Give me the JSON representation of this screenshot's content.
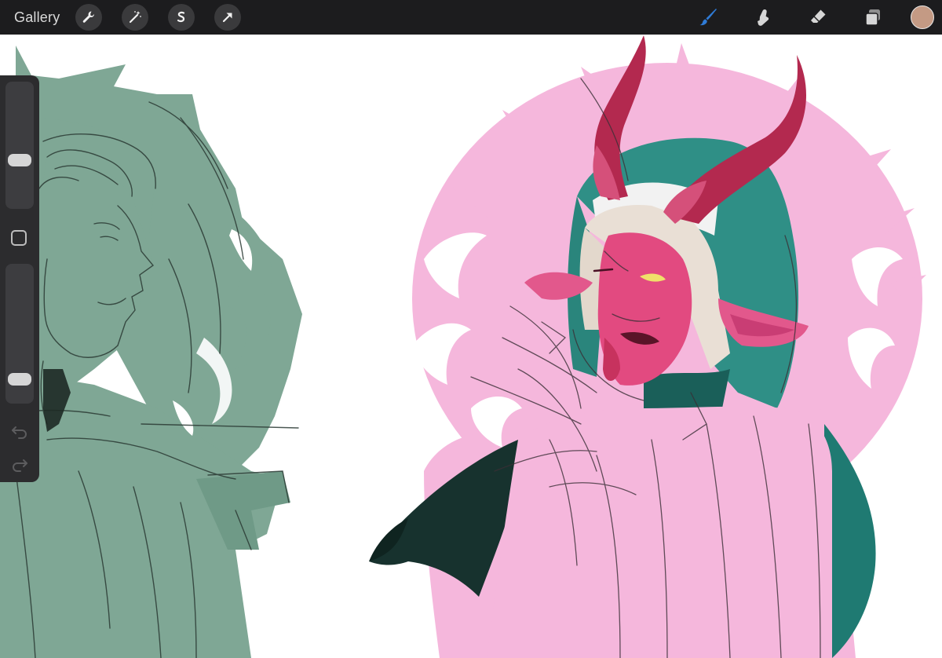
{
  "toolbar": {
    "gallery_label": "Gallery",
    "left_tools": [
      {
        "name": "wrench-icon"
      },
      {
        "name": "magic-wand-icon"
      },
      {
        "name": "selection-icon"
      },
      {
        "name": "transform-arrow-icon"
      }
    ],
    "right_tools": [
      {
        "name": "brush-icon",
        "active": true,
        "color": "#2f7bd6"
      },
      {
        "name": "smudge-icon"
      },
      {
        "name": "eraser-icon"
      },
      {
        "name": "layers-icon"
      }
    ],
    "current_color": "#c49a84"
  },
  "sidebar": {
    "brush_size_level": 0.37,
    "opacity_level": 0.14,
    "undo_icon": "undo-icon",
    "redo_icon": "redo-icon"
  },
  "colors": {
    "toolbar_bg": "#1c1c1e",
    "sidebar_bg": "#2c2c2e",
    "sketch_green": "#7fa795",
    "pink": "#f5b7dc",
    "demon_skin": "#e24a80",
    "horn": "#b3294f",
    "hood_teal": "#2f8f86"
  }
}
